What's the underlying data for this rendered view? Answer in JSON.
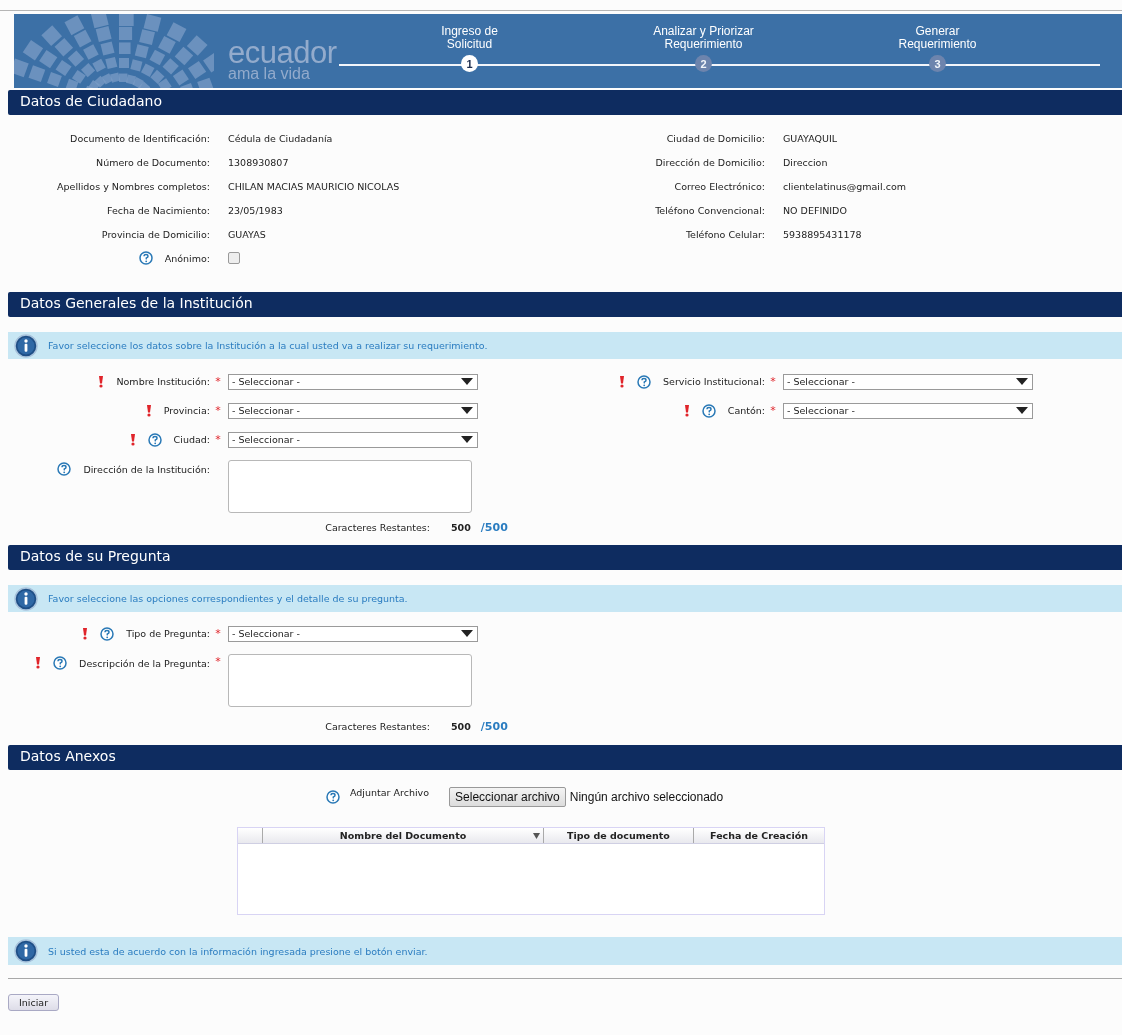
{
  "header": {
    "logo": {
      "name": "ecuador",
      "tagline": "ama la vida"
    },
    "steps": [
      {
        "number": "1",
        "label_lines": [
          "Ingreso de",
          "Solicitud"
        ],
        "selected": true
      },
      {
        "number": "2",
        "label_lines": [
          "Analizar y Priorizar",
          "Requerimiento"
        ],
        "selected": false
      },
      {
        "number": "3",
        "label_lines": [
          "Generar",
          "Requerimiento"
        ],
        "selected": false
      }
    ]
  },
  "citizen": {
    "title": "Datos de Ciudadano",
    "left": [
      {
        "label": "Documento de Identificación:",
        "value": "Cédula de Ciudadanía"
      },
      {
        "label": "Número de Documento:",
        "value": "1308930807"
      },
      {
        "label": "Apellidos y Nombres completos:",
        "value": "CHILAN MACIAS MAURICIO NICOLAS"
      },
      {
        "label": "Fecha de Nacimiento:",
        "value": "23/05/1983"
      },
      {
        "label": "Provincia de Domicilio:",
        "value": "GUAYAS"
      }
    ],
    "right": [
      {
        "label": "Ciudad de Domicilio:",
        "value": "GUAYAQUIL"
      },
      {
        "label": "Dirección de Domicilio:",
        "value": "Direccion"
      },
      {
        "label": "Correo Electrónico:",
        "value": "clientelatinus@gmail.com"
      },
      {
        "label": "Teléfono Convencional:",
        "value": "NO DEFINIDO"
      },
      {
        "label": "Teléfono Celular:",
        "value": "5938895431178"
      }
    ],
    "anonymous": {
      "label": "Anónimo:",
      "help": true,
      "checked": false
    }
  },
  "institution": {
    "title": "Datos Generales de la Institución",
    "info": "Favor seleccione los datos sobre la Institución a la cual usted va a realizar su requerimiento.",
    "rows": [
      [
        {
          "kind": "select",
          "label": "Nombre Institución:",
          "required": true,
          "help": false,
          "mark": "*",
          "value": "- Seleccionar -"
        },
        {
          "kind": "select",
          "label": "Servicio Institucional:",
          "required": true,
          "help": true,
          "mark": "*",
          "value": "- Seleccionar -"
        }
      ],
      [
        {
          "kind": "select",
          "label": "Provincia:",
          "required": true,
          "help": false,
          "mark": "*",
          "value": "- Seleccionar -"
        },
        {
          "kind": "select",
          "label": "Cantón:",
          "required": true,
          "help": true,
          "mark": "*",
          "value": "- Seleccionar -"
        }
      ],
      [
        {
          "kind": "select",
          "label": "Ciudad:",
          "required": true,
          "help": true,
          "mark": "*",
          "value": "- Seleccionar -"
        }
      ],
      [
        {
          "kind": "textarea",
          "label": "Dirección de la Institución:",
          "required": false,
          "help": true
        }
      ]
    ],
    "counter": {
      "label": "Caracteres Restantes:",
      "remaining": "500",
      "max": "/500"
    }
  },
  "question": {
    "title": "Datos de su Pregunta",
    "info": "Favor seleccione las opciones correspondientes y el detalle de su pregunta.",
    "rows": [
      [
        {
          "kind": "select",
          "label": "Tipo de Pregunta:",
          "required": true,
          "help": true,
          "mark": "*",
          "value": "- Seleccionar -"
        }
      ],
      [
        {
          "kind": "textarea",
          "label": "Descripción de la Pregunta:",
          "required": true,
          "help": true,
          "mark": "*"
        }
      ]
    ],
    "counter": {
      "label": "Caracteres Restantes:",
      "remaining": "500",
      "max": "/500"
    }
  },
  "attachments": {
    "title": "Datos Anexos",
    "label": "Adjuntar Archivo",
    "help": true,
    "button": "Seleccionar archivo",
    "status": "Ningún archivo seleccionado",
    "columns": [
      {
        "label": "Nombre del Documento",
        "sortable": true
      },
      {
        "label": "Tipo de documento",
        "sortable": false
      },
      {
        "label": "Fecha de Creación",
        "sortable": false
      }
    ]
  },
  "footer": {
    "info": "Si usted esta de acuerdo con la información ingresada presione el botón enviar.",
    "button": "Iniciar"
  }
}
